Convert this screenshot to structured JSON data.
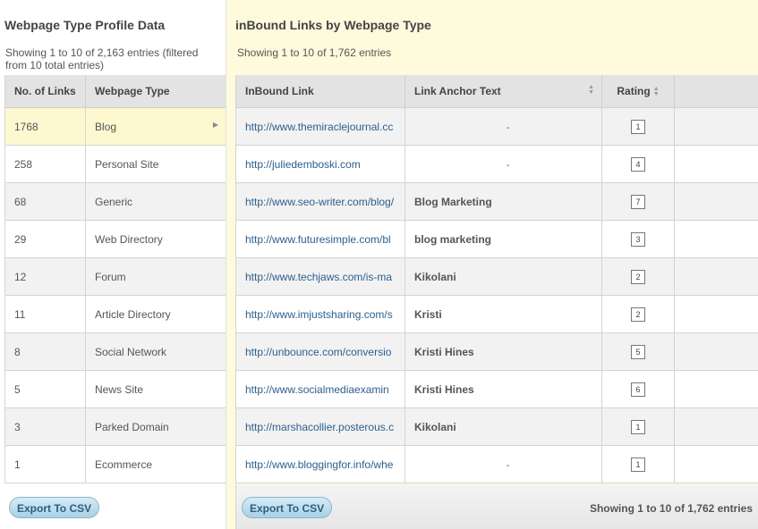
{
  "left_panel": {
    "title": "Webpage Type Profile Data",
    "info": "Showing 1 to 10 of 2,163 entries (filtered from 10 total entries)",
    "columns": [
      "No. of Links",
      "Webpage Type"
    ],
    "rows": [
      {
        "links": "1768",
        "type": "Blog"
      },
      {
        "links": "258",
        "type": "Personal Site"
      },
      {
        "links": "68",
        "type": "Generic"
      },
      {
        "links": "29",
        "type": "Web Directory"
      },
      {
        "links": "12",
        "type": "Forum"
      },
      {
        "links": "11",
        "type": "Article Directory"
      },
      {
        "links": "8",
        "type": "Social Network"
      },
      {
        "links": "5",
        "type": "News Site"
      },
      {
        "links": "3",
        "type": "Parked Domain"
      },
      {
        "links": "1",
        "type": "Ecommerce"
      }
    ],
    "export_label": "Export To CSV"
  },
  "right_panel": {
    "title": "inBound Links by Webpage Type",
    "info": "Showing 1 to 10 of 1,762 entries",
    "columns": [
      "InBound Link",
      "Link Anchor Text",
      "Rating"
    ],
    "rows": [
      {
        "link": "http://www.themiraclejournal.cc",
        "anchor": "-",
        "rating": "1"
      },
      {
        "link": "http://juliedemboski.com",
        "anchor": "-",
        "rating": "4"
      },
      {
        "link": "http://www.seo-writer.com/blog/",
        "anchor": "Blog Marketing",
        "rating": "7"
      },
      {
        "link": "http://www.futuresimple.com/bl",
        "anchor": "blog marketing",
        "rating": "3"
      },
      {
        "link": "http://www.techjaws.com/is-ma",
        "anchor": "Kikolani",
        "rating": "2"
      },
      {
        "link": "http://www.imjustsharing.com/s",
        "anchor": "Kristi",
        "rating": "2"
      },
      {
        "link": "http://unbounce.com/conversio",
        "anchor": "Kristi Hines",
        "rating": "5"
      },
      {
        "link": "http://www.socialmediaexamin",
        "anchor": "Kristi Hines",
        "rating": "6"
      },
      {
        "link": "http://marshacollier.posterous.c",
        "anchor": "Kikolani",
        "rating": "1"
      },
      {
        "link": "http://www.bloggingfor.info/whe",
        "anchor": "-",
        "rating": "1"
      }
    ],
    "export_label": "Export To CSV",
    "footer_info": "Showing 1 to 10 of 1,762 entries"
  },
  "icons": {
    "row_arrow": "chevron-right-icon",
    "sort": "sort-icon"
  },
  "colors": {
    "selected_row": "#fdf8d0",
    "link": "#2c5f8d",
    "right_panel_bg": "#fdfbdc",
    "button": "#a9d0e4"
  }
}
